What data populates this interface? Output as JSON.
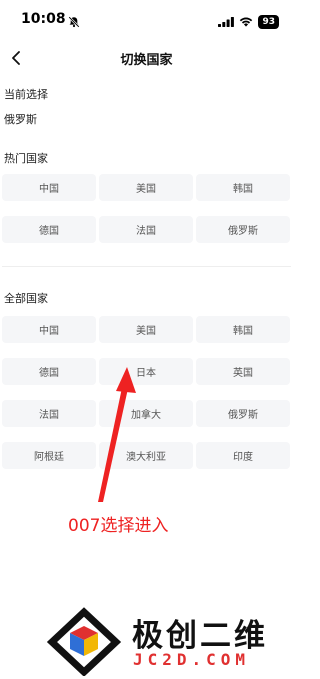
{
  "status_bar": {
    "time": "10:08",
    "battery": "93"
  },
  "nav": {
    "title": "切换国家"
  },
  "current": {
    "title": "当前选择",
    "value": "俄罗斯"
  },
  "hot": {
    "title": "热门国家",
    "items": [
      "中国",
      "美国",
      "韩国",
      "德国",
      "法国",
      "俄罗斯"
    ]
  },
  "all": {
    "title": "全部国家",
    "items": [
      "中国",
      "美国",
      "韩国",
      "德国",
      "日本",
      "英国",
      "法国",
      "加拿大",
      "俄罗斯",
      "阿根廷",
      "澳大利亚",
      "印度"
    ]
  },
  "annotation": {
    "text": "007选择进入",
    "color": "#ee2222"
  },
  "watermark": {
    "name": "极创二维",
    "domain": "JC2D.COM"
  },
  "icons": {
    "back": "chevron-left-icon",
    "mute": "bell-slash-icon",
    "signal": "signal-icon",
    "wifi": "wifi-icon"
  }
}
